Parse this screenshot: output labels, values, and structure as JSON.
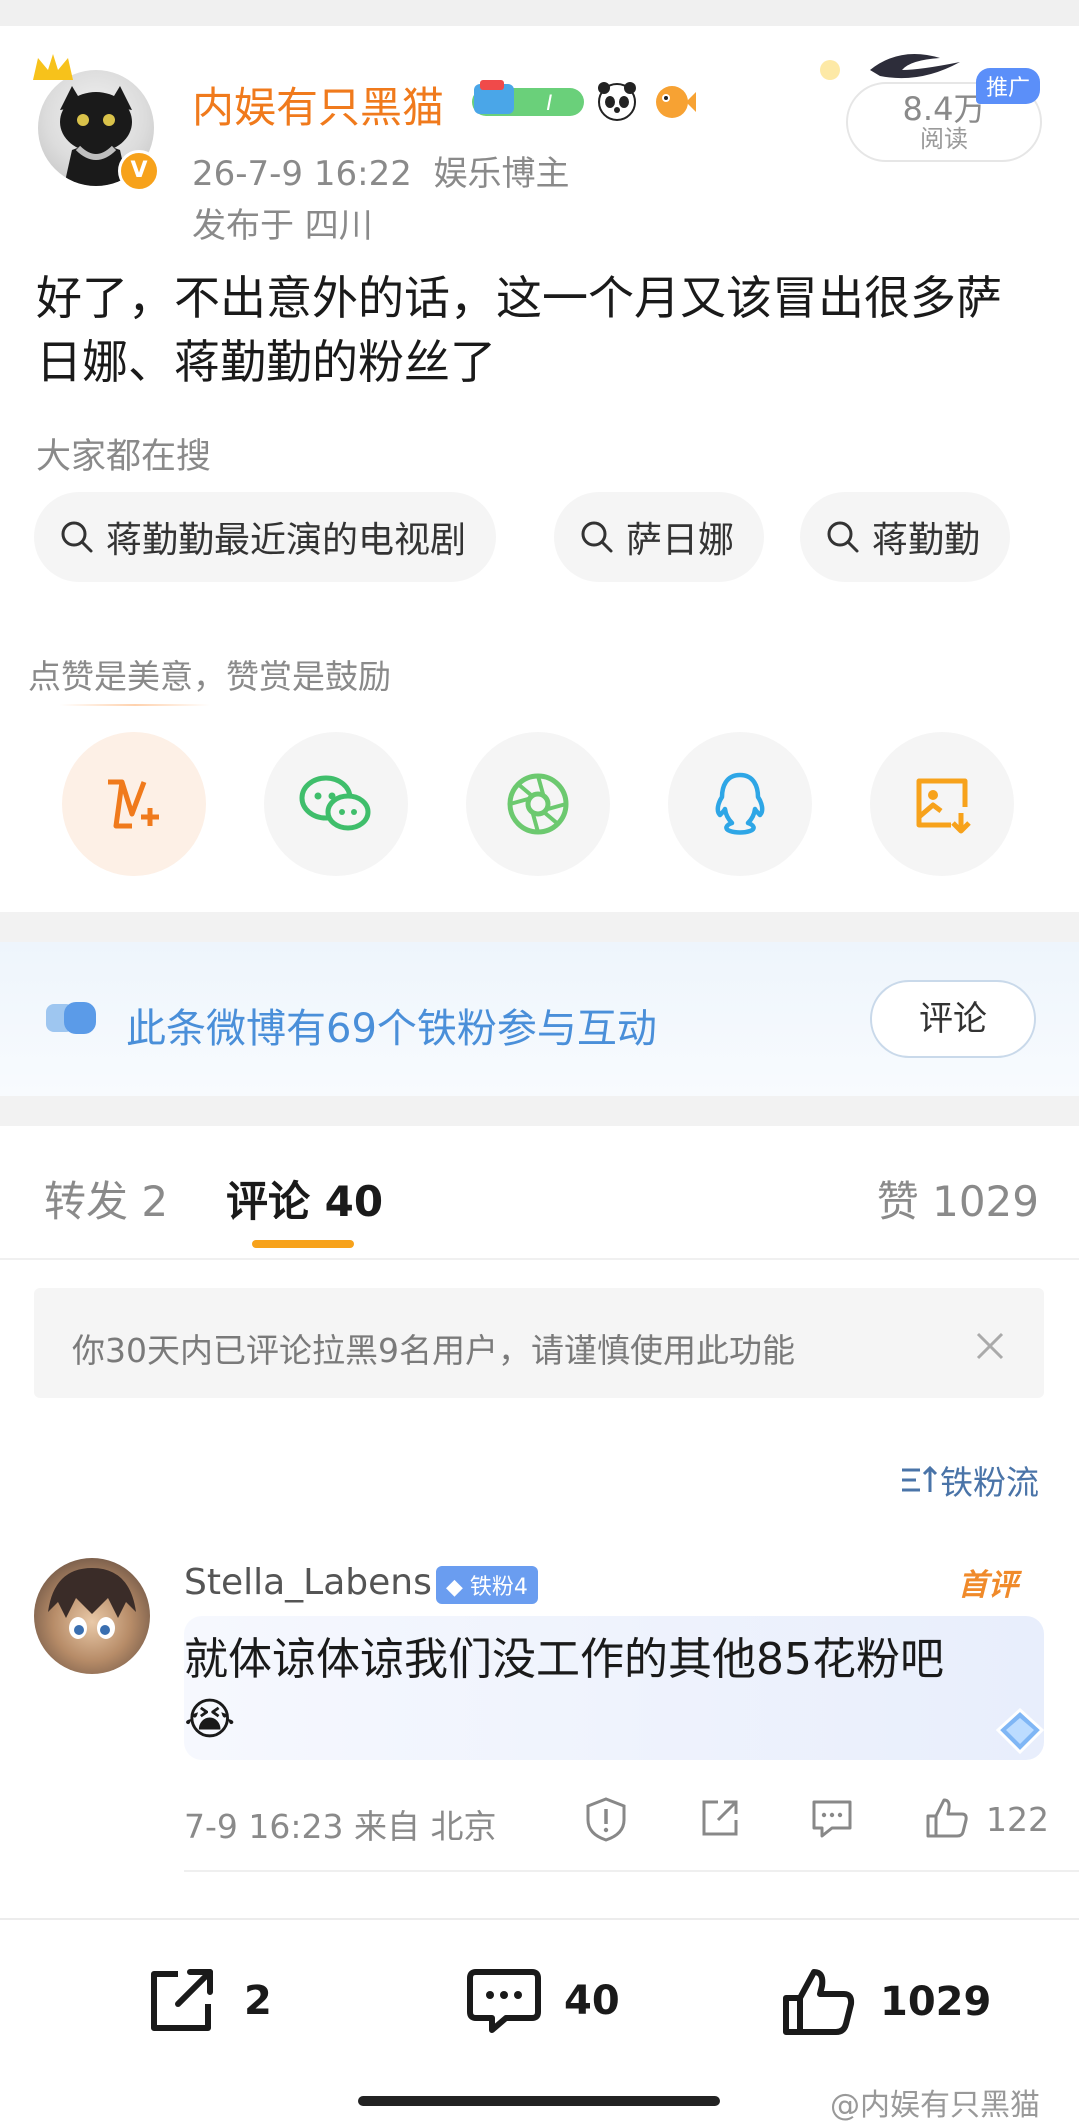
{
  "post": {
    "author_name": "内娱有只黑猫",
    "timestamp": "26-7-9 16:22",
    "author_role": "娱乐博主",
    "location": "发布于 四川",
    "read_count": "8.4万",
    "read_label": "阅读",
    "ad_badge": "推广",
    "text": "好了，不出意外的话，这一个月又该冒出很多萨日娜、蒋勤勤的粉丝了",
    "verified_mark": "V"
  },
  "search": {
    "label": "大家都在搜",
    "chips": [
      "蒋勤勤最近演的电视剧",
      "萨日娜",
      "蒋勤勤"
    ]
  },
  "share": {
    "praise_text": "点赞是美意，赞赏是鼓励",
    "icons": [
      "reward-icon",
      "wechat-icon",
      "moments-icon",
      "qq-icon",
      "save-image-icon"
    ]
  },
  "fan_bar": {
    "text": "此条微博有69个铁粉参与互动",
    "button": "评论"
  },
  "tabs": {
    "repost": "转发 2",
    "comment": "评论 40",
    "like": "赞 1029"
  },
  "notice": {
    "text": "你30天内已评论拉黑9名用户，请谨慎使用此功能"
  },
  "sort": {
    "label": "铁粉流"
  },
  "comment": {
    "username": "Stella_Labens",
    "fan_badge": "铁粉4",
    "first_badge": "首评",
    "text": "就体谅体谅我们没工作的其他85花粉吧",
    "emoji": "😭",
    "meta": "7-9 16:23  来自 北京",
    "like_count": "122"
  },
  "bottom_bar": {
    "repost_count": "2",
    "comment_count": "40",
    "like_count": "1029"
  },
  "watermark": "@内娱有只黑猫",
  "colors": {
    "brand_orange": "#f07a1c",
    "link_blue": "#4a8fd9",
    "tab_underline": "#f7a21b"
  }
}
